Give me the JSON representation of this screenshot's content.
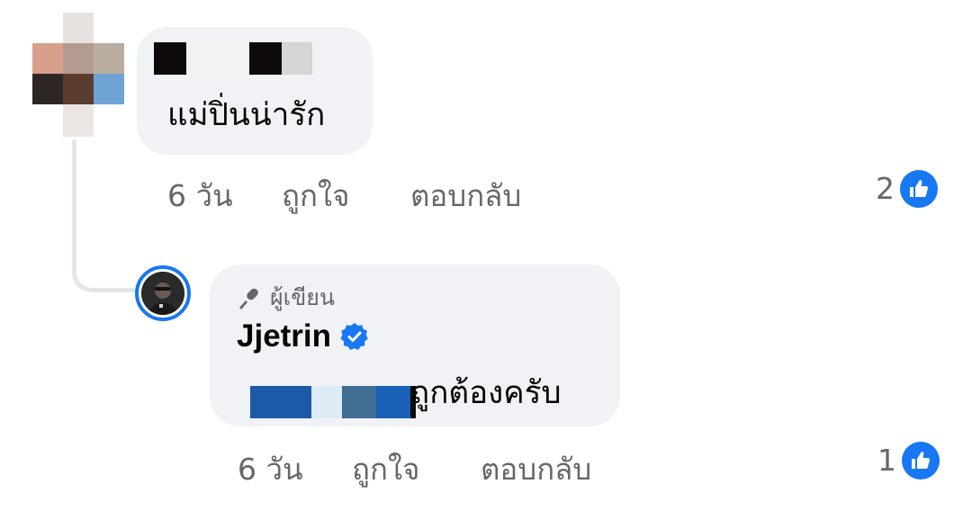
{
  "comment": {
    "text": "แม่ปิ่นน่ารัก",
    "time": "6 วัน",
    "like_label": "ถูกใจ",
    "reply_label": "ตอบกลับ",
    "reaction_count": "2",
    "reaction_icon": "like-icon"
  },
  "reply": {
    "author_badge": "ผู้เขียน",
    "author_badge_icon": "microphone-icon",
    "name": "Jjetrin",
    "verified_icon": "verified-badge-icon",
    "text": "ถูกต้องครับ",
    "time": "6 วัน",
    "like_label": "ถูกใจ",
    "reply_label": "ตอบกลับ",
    "reaction_count": "1",
    "reaction_icon": "like-icon"
  },
  "colors": {
    "bubble": "#f0f2f5",
    "secondary_text": "#65676b",
    "accent_blue": "#1877f2",
    "thread_line": "#e4e6eb"
  }
}
